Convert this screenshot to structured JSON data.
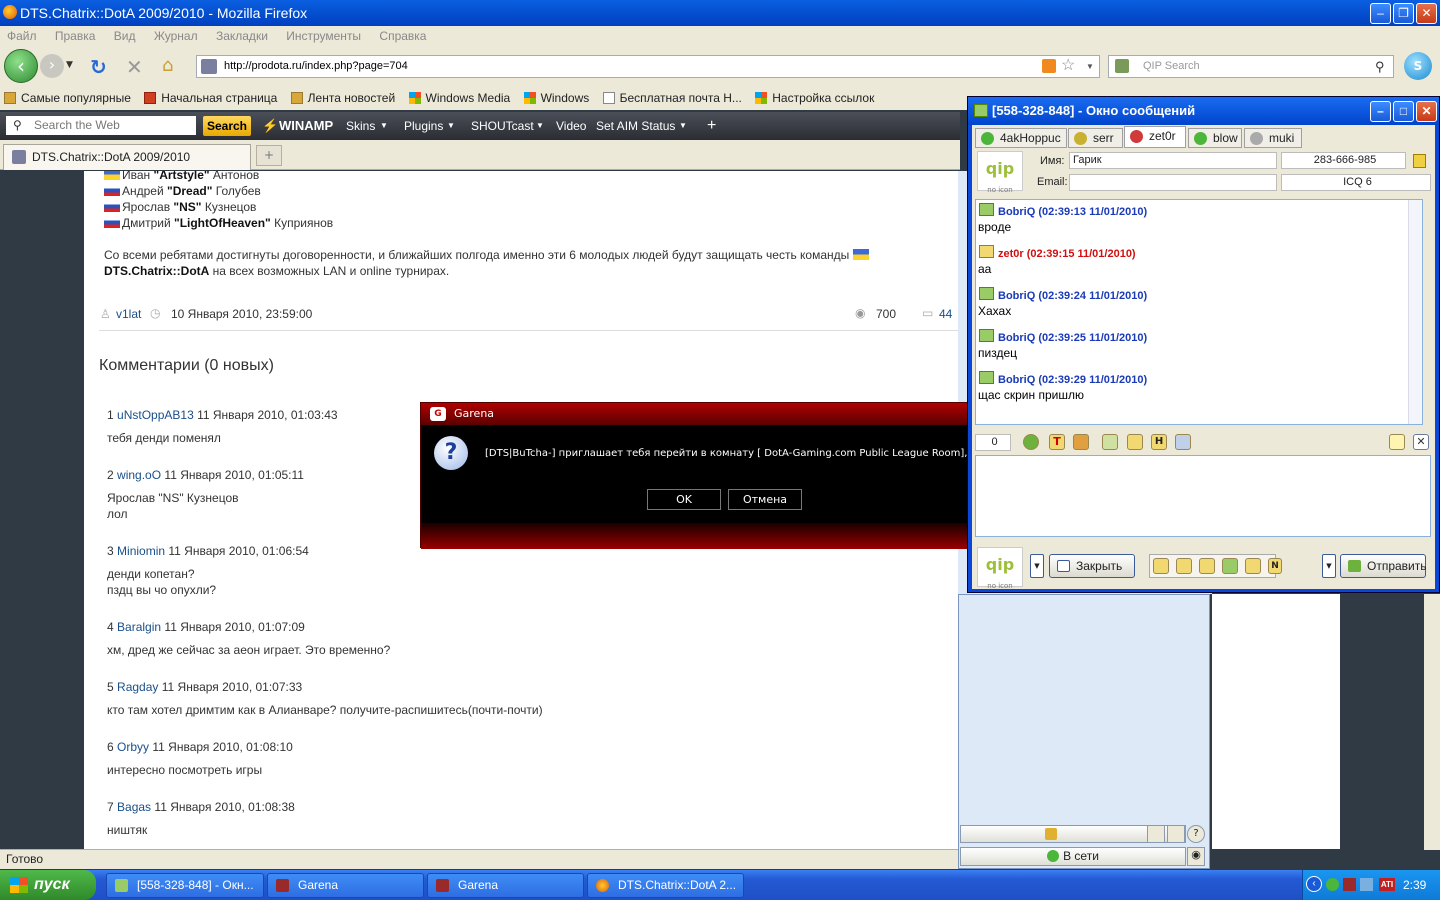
{
  "firefox": {
    "title": "DTS.Chatrix::DotA 2009/2010 - Mozilla Firefox",
    "menu": [
      "Файл",
      "Правка",
      "Вид",
      "Журнал",
      "Закладки",
      "Инструменты",
      "Справка"
    ],
    "url": "http://prodota.ru/index.php?page=704",
    "search_placeholder": "QIP Search",
    "bookmarks": [
      "Самые популярные",
      "Начальная страница",
      "Лента новостей",
      "Windows Media",
      "Windows",
      "Бесплатная почта H...",
      "Настройка ссылок"
    ],
    "winamp": {
      "search_placeholder": "Search the Web",
      "search_button": "Search",
      "items": [
        "WINAMP",
        "Skins",
        "Plugins",
        "SHOUTcast",
        "Video",
        "Set AIM Status"
      ]
    },
    "tab_title": "DTS.Chatrix::DotA 2009/2010",
    "status": "Готово"
  },
  "page": {
    "players": [
      {
        "first": "Иван",
        "nick": "\"Artstyle\"",
        "last": "Антонов"
      },
      {
        "first": "Андрей",
        "nick": "\"Dread\"",
        "last": "Голубев"
      },
      {
        "first": "Ярослав",
        "nick": "\"NS\"",
        "last": "Кузнецов"
      },
      {
        "first": "Дмитрий",
        "nick": "\"LightOfHeaven\"",
        "last": "Куприянов"
      }
    ],
    "para1": "Со всеми ребятами достигнуты договоренности, и ближайших полгода именно эти 6 молодых людей будут защищать честь команды",
    "para2_team": "DTS.Chatrix::DotA",
    "para2_rest": "на всех возможных LAN и online турнирах.",
    "author": "v1lat",
    "date": "10 Января 2010, 23:59:00",
    "views": "700",
    "comments_count": "44",
    "comments_heading": "Комментарии (0 новых)",
    "comments": [
      {
        "num": "1",
        "user": "uNstOppAB13",
        "date": "11 Января 2010, 01:03:43",
        "lines": [
          "тебя денди поменял"
        ]
      },
      {
        "num": "2",
        "user": "wing.oO",
        "date": "11 Января 2010, 01:05:11",
        "lines": [
          "Ярослав \"NS\" Кузнецов",
          "лол"
        ]
      },
      {
        "num": "3",
        "user": "Miniomin",
        "date": "11 Января 2010, 01:06:54",
        "lines": [
          "денди копетан?",
          "пздц вы чо опухли?"
        ]
      },
      {
        "num": "4",
        "user": "Baralgin",
        "date": "11 Января 2010, 01:07:09",
        "lines": [
          "хм, дред же сейчас за аеон играет. Это временно?"
        ]
      },
      {
        "num": "5",
        "user": "Ragday",
        "date": "11 Января 2010, 01:07:33",
        "lines": [
          "кто там хотел дримтим как в Алианваре? получите-распишитесь(почти-почти)"
        ]
      },
      {
        "num": "6",
        "user": "Orbyy",
        "date": "11 Января 2010, 01:08:10",
        "lines": [
          "интересно посмотреть игры"
        ]
      },
      {
        "num": "7",
        "user": "Bagas",
        "date": "11 Января 2010, 01:08:38",
        "lines": [
          "ништяк"
        ]
      }
    ]
  },
  "garena": {
    "title": "Garena",
    "message": "[DTS|BuTcha-] приглашает тебя перейти в комнату [ DotA-Gaming.com Public League Room],вы с",
    "ok": "OK",
    "cancel": "Отмена"
  },
  "qip": {
    "title": "[558-328-848] - Окно сообщений",
    "tabs": [
      "4akНорpuc",
      "serr",
      "zet0r",
      "blow",
      "muki"
    ],
    "name_label": "Имя:",
    "name_value": "Гарик",
    "uin": "283-666-985",
    "email_label": "Email:",
    "client": "ICQ 6",
    "messages": [
      {
        "from": "BobriQ (02:39:13 11/01/2010)",
        "text": "вроде",
        "color": "#1a3ab8"
      },
      {
        "from": "zet0r (02:39:15 11/01/2010)",
        "text": "аа",
        "color": "#d01010"
      },
      {
        "from": "BobriQ (02:39:24 11/01/2010)",
        "text": "Хахах",
        "color": "#1a3ab8"
      },
      {
        "from": "BobriQ (02:39:25 11/01/2010)",
        "text": "пиздец",
        "color": "#1a3ab8"
      },
      {
        "from": "BobriQ (02:39:29 11/01/2010)",
        "text": "щас скрин пришлю",
        "color": "#1a3ab8"
      }
    ],
    "counter": "0",
    "logo_text": "qip",
    "logo_sub": "no icon",
    "close_label": "Закрыть",
    "send_label": "Отправить",
    "status": "В сети"
  },
  "taskbar": {
    "start": "пуск",
    "items": [
      "[558-328-848] - Окн...",
      "Garena",
      "Garena",
      "DTS.Chatrix::DotA 2..."
    ],
    "clock": "2:39"
  }
}
